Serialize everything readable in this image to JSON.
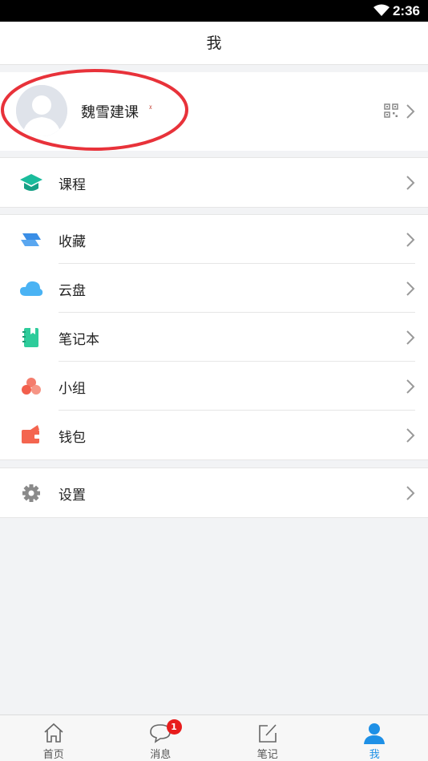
{
  "status_bar": {
    "time": "2:36"
  },
  "header": {
    "title": "我"
  },
  "profile": {
    "name": "魏雪建课",
    "name_mark": "ᵡ"
  },
  "menu_groups": [
    [
      {
        "label": "课程",
        "icon": "graduation-cap-icon",
        "color": "#1abc9c"
      }
    ],
    [
      {
        "label": "收藏",
        "icon": "bookmark-layers-icon",
        "color": "#3a8ee6"
      },
      {
        "label": "云盘",
        "icon": "cloud-icon",
        "color": "#4ab3f4"
      },
      {
        "label": "笔记本",
        "icon": "notebook-icon",
        "color": "#2ecc9b"
      },
      {
        "label": "小组",
        "icon": "group-icon",
        "color": "#f47c6c"
      },
      {
        "label": "钱包",
        "icon": "wallet-icon",
        "color": "#f4654f"
      }
    ],
    [
      {
        "label": "设置",
        "icon": "gear-icon",
        "color": "#8a8a8a"
      }
    ]
  ],
  "tabs": [
    {
      "label": "首页",
      "icon": "home-icon"
    },
    {
      "label": "消息",
      "icon": "message-icon",
      "badge": "1"
    },
    {
      "label": "笔记",
      "icon": "edit-icon"
    },
    {
      "label": "我",
      "icon": "person-icon",
      "active": true
    }
  ],
  "colors": {
    "accent": "#1e90e6",
    "annotation": "#e8323a",
    "badge": "#e81c1c"
  }
}
